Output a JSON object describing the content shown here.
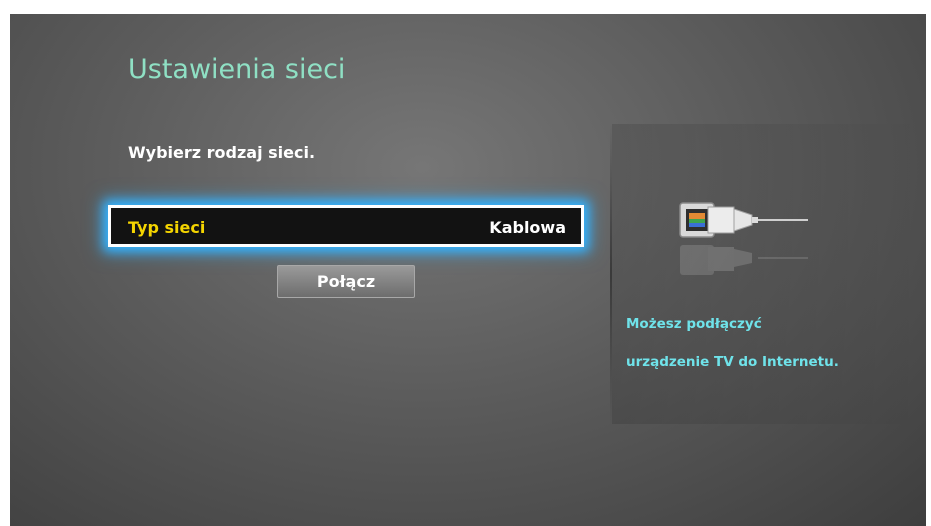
{
  "screen": {
    "title": "Ustawienia sieci",
    "prompt": "Wybierz rodzaj sieci."
  },
  "network_type": {
    "label": "Typ sieci",
    "value": "Kablowa"
  },
  "connect_button": {
    "label": "Połącz"
  },
  "info_panel": {
    "icon": "ethernet-cable-icon",
    "line1": "Możesz podłączyć",
    "line2": "urządzenie TV do Internetu."
  },
  "colors": {
    "title": "#8fe0c4",
    "selected_label": "#f4d400",
    "focus_glow": "#34b3ff",
    "info_text": "#6fe3ea"
  }
}
